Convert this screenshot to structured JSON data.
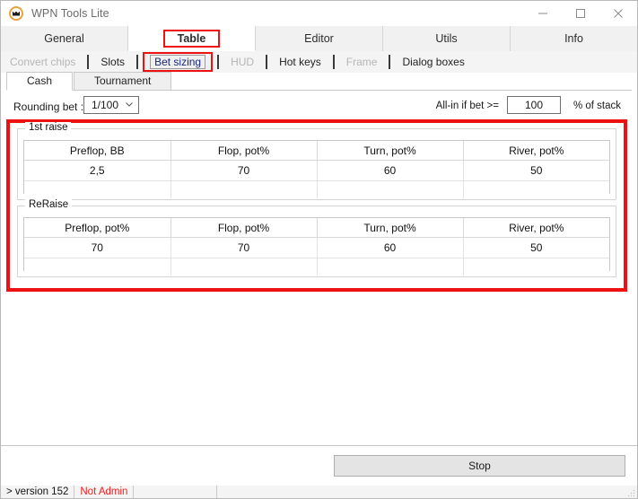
{
  "window": {
    "title": "WPN Tools Lite",
    "icon": "crown-circle-icon",
    "minimize_label": "minimize-icon",
    "maximize_label": "maximize-icon",
    "close_label": "close-icon"
  },
  "main_tabs": [
    {
      "label": "General",
      "active": false
    },
    {
      "label": "Table",
      "active": true,
      "annotated": true
    },
    {
      "label": "Editor",
      "active": false
    },
    {
      "label": "Utils",
      "active": false
    },
    {
      "label": "Info",
      "active": false
    }
  ],
  "sub_tabs": [
    {
      "label": "Convert chips",
      "disabled": true,
      "selected": false
    },
    {
      "label": "Slots",
      "disabled": false,
      "selected": false
    },
    {
      "label": "Bet sizing",
      "disabled": false,
      "selected": true,
      "annotated": true
    },
    {
      "label": "HUD",
      "disabled": true,
      "selected": false
    },
    {
      "label": "Hot keys",
      "disabled": false,
      "selected": false
    },
    {
      "label": "Frame",
      "disabled": true,
      "selected": false
    },
    {
      "label": "Dialog boxes",
      "disabled": false,
      "selected": false
    }
  ],
  "inner_tabs": [
    {
      "label": "Cash",
      "active": true
    },
    {
      "label": "Tournament",
      "active": false
    }
  ],
  "options": {
    "rounding_label": "Rounding bet :",
    "rounding_value": "1/100",
    "rounding_options": [
      "1/100"
    ],
    "allin_label": "All-in if bet >=",
    "allin_value": "100",
    "allin_suffix": "% of stack"
  },
  "groups": [
    {
      "legend": "1st raise",
      "headers": [
        "Preflop, BB",
        "Flop, pot%",
        "Turn, pot%",
        "River, pot%"
      ],
      "values": [
        "2,5",
        "70",
        "60",
        "50"
      ]
    },
    {
      "legend": "ReRaise",
      "headers": [
        "Preflop, pot%",
        "Flop, pot%",
        "Turn, pot%",
        "River, pot%"
      ],
      "values": [
        "70",
        "70",
        "60",
        "50"
      ]
    }
  ],
  "actionbar": {
    "stop_label": "Stop"
  },
  "statusbar": {
    "version": "> version 152",
    "admin": "Not Admin"
  },
  "colors": {
    "annotation_red": "#ee1111",
    "selected_tab_text": "#18267a",
    "status_warning": "#ee2222",
    "icon_gold": "#e8a33d"
  }
}
